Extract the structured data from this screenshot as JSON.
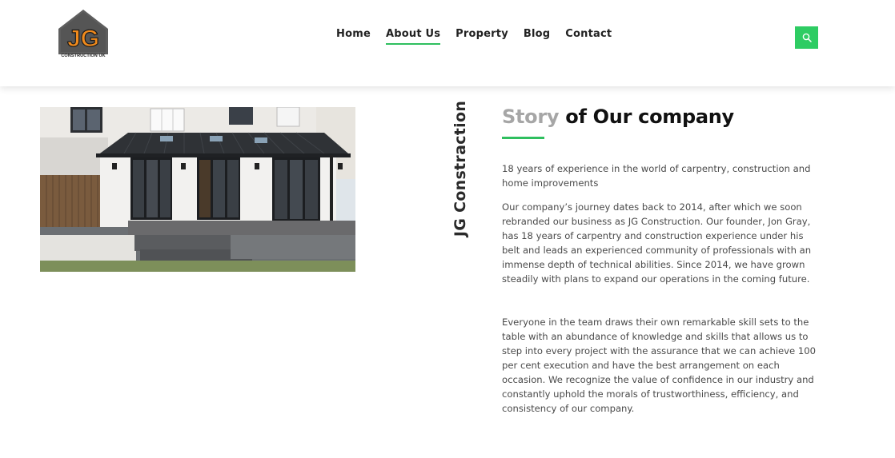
{
  "header": {
    "logo_letters": "JG",
    "logo_subtitle": "CONSTRUCTION UK",
    "nav": [
      {
        "label": "Home",
        "active": false
      },
      {
        "label": "About Us",
        "active": true
      },
      {
        "label": "Property",
        "active": false
      },
      {
        "label": "Blog",
        "active": false
      },
      {
        "label": "Contact",
        "active": false
      }
    ],
    "search_icon": "search-icon"
  },
  "colors": {
    "accent": "#2ecc63",
    "heading_muted": "#a6a6a6",
    "logo_orange": "#f08a1c",
    "logo_gray": "#5e5e5e"
  },
  "about": {
    "vertical_title": "JG Constraction",
    "heading_muted": "Story",
    "heading_rest": " of Our company",
    "paragraphs": [
      "18 years of experience in the world of carpentry, construction and home improvements",
      "Our company’s journey dates back to 2014, after which we soon rebranded our business as JG Construction. Our founder, Jon Gray, has 18 years of carpentry and construction experience under his belt and leads an experienced community of professionals with an immense depth of technical abilities. Since 2014, we have grown steadily with plans to expand our operations in the coming future.",
      "Everyone in the team draws their own remarkable skill sets to the table with an abundance of knowledge and skills that allows us to step into every project with the assurance that we can achieve 100 per cent execution and have the best arrangement on each occasion. We recognize the value of confidence in our industry and constantly uphold the morals of trustworthiness, efficiency, and consistency of our company."
    ]
  }
}
